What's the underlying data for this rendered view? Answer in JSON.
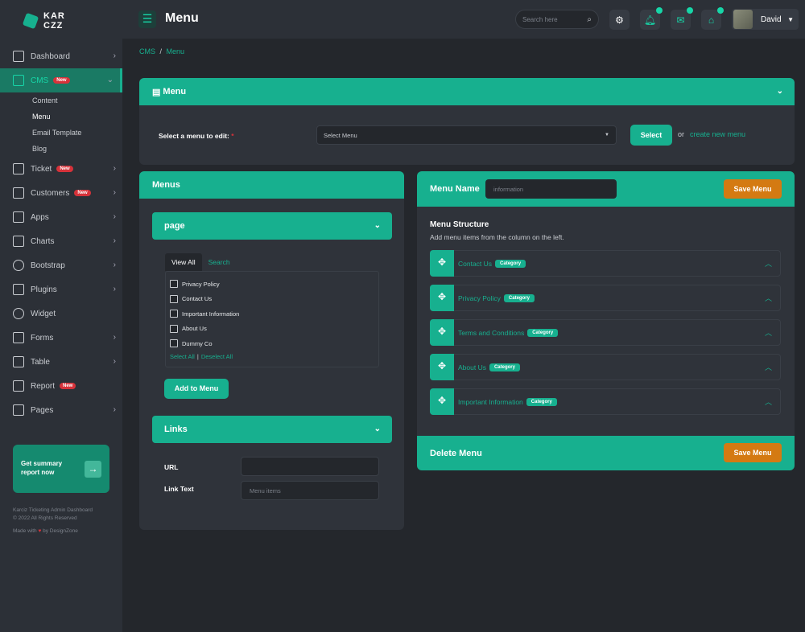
{
  "brand": {
    "line1": "KAR",
    "line2": "CZZ"
  },
  "sidebar": {
    "items": [
      {
        "label": "Dashboard",
        "icon": "grid-icon",
        "badge": "",
        "chevron": "›"
      },
      {
        "label": "CMS",
        "icon": "chart-bars-icon",
        "badge": "New",
        "chevron": "⌄"
      },
      {
        "label": "Ticket",
        "icon": "ticket-icon",
        "badge": "New",
        "chevron": "›"
      },
      {
        "label": "Customers",
        "icon": "building-icon",
        "badge": "New",
        "chevron": "›"
      },
      {
        "label": "Apps",
        "icon": "monitor-icon",
        "badge": "",
        "chevron": "›"
      },
      {
        "label": "Charts",
        "icon": "line-chart-icon",
        "badge": "",
        "chevron": "›"
      },
      {
        "label": "Bootstrap",
        "icon": "globe-icon",
        "badge": "",
        "chevron": "›"
      },
      {
        "label": "Plugins",
        "icon": "puzzle-icon",
        "badge": "",
        "chevron": "›"
      },
      {
        "label": "Widget",
        "icon": "gear-icon",
        "badge": "",
        "chevron": ""
      },
      {
        "label": "Forms",
        "icon": "form-icon",
        "badge": "",
        "chevron": "›"
      },
      {
        "label": "Table",
        "icon": "table-icon",
        "badge": "",
        "chevron": "›"
      },
      {
        "label": "Report",
        "icon": "report-icon",
        "badge": "New",
        "chevron": ""
      },
      {
        "label": "Pages",
        "icon": "pages-icon",
        "badge": "",
        "chevron": "›"
      }
    ],
    "cms_sub": [
      "Content",
      "Menu",
      "Email Template",
      "Blog"
    ],
    "promo": "Get summary report now",
    "footer_line1": "Karciz Ticketing Admin Dashboard",
    "footer_line2": "© 2022 All Rights Reserved",
    "footer_made": "Made with",
    "footer_by": "by DesignZone"
  },
  "topbar": {
    "title": "Menu",
    "search_placeholder": "Search here",
    "user": "David"
  },
  "breadcrumb": {
    "parent": "CMS",
    "sep": "/",
    "current": "Menu"
  },
  "menu_card": {
    "title": "Menu",
    "select_label": "Select a menu to edit:",
    "required": "*",
    "select_value": "Select Menu",
    "select_button": "Select",
    "or": "or",
    "create_link": "create new menu"
  },
  "menus_card": {
    "title": "Menus",
    "page_acc": "page",
    "tab_view_all": "View All",
    "tab_search": "Search",
    "checkboxes": [
      "Privacy Policy",
      "Contact Us",
      "Important Information",
      "About Us",
      "Dummy Co"
    ],
    "select_all": "Select All",
    "divider": "|",
    "deselect_all": "Deselect All",
    "add_button": "Add to Menu",
    "links_acc": "Links",
    "url_label": "URL",
    "url_value": "",
    "link_text_label": "Link Text",
    "link_text_placeholder": "Menu items"
  },
  "structure_card": {
    "menu_name_label": "Menu Name",
    "menu_name_placeholder": "information",
    "save_top": "Save Menu",
    "title": "Menu Structure",
    "subtitle": "Add menu items from the column on the left.",
    "items": [
      {
        "label": "Contact Us",
        "tag": "Category"
      },
      {
        "label": "Privacy Policy",
        "tag": "Category"
      },
      {
        "label": "Terms and Conditions",
        "tag": "Category"
      },
      {
        "label": "About Us",
        "tag": "Category"
      },
      {
        "label": "Important Information",
        "tag": "Category"
      }
    ],
    "delete_label": "Delete Menu",
    "save_bottom": "Save Menu"
  },
  "colors": {
    "accent": "#17b08f",
    "danger": "#d6323a",
    "warning": "#d47a12",
    "bg": "#24272c",
    "panel": "#2f333a"
  }
}
